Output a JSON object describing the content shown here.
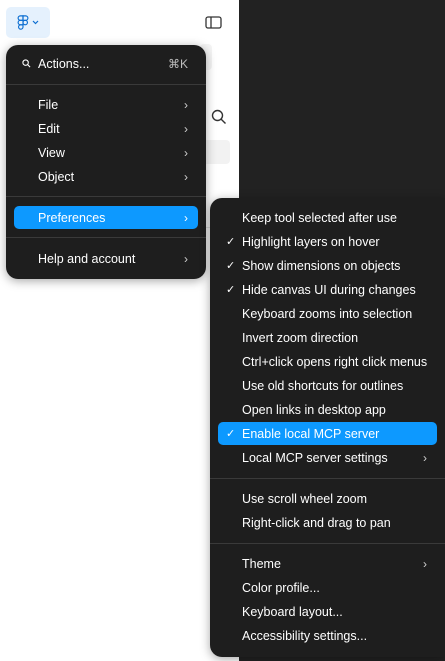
{
  "toolbar": {
    "logo_icon": "figma-logo-icon",
    "dropdown_icon": "chevron-down-icon",
    "sidebar_toggle_icon": "sidebar-toggle-icon",
    "search_icon": "search-icon"
  },
  "main_menu": {
    "actions_label": "Actions...",
    "actions_shortcut": "⌘K",
    "items": [
      {
        "label": "File",
        "arrow": "›"
      },
      {
        "label": "Edit",
        "arrow": "›"
      },
      {
        "label": "View",
        "arrow": "›"
      },
      {
        "label": "Object",
        "arrow": "›"
      },
      {
        "label": "Preferences",
        "arrow": "›",
        "active": true
      },
      {
        "label": "Help and account",
        "arrow": "›"
      }
    ]
  },
  "preferences_menu": {
    "items": [
      {
        "label": "Keep tool selected after use",
        "checked": false
      },
      {
        "label": "Highlight layers on hover",
        "checked": true,
        "check": "✓"
      },
      {
        "label": "Show dimensions on objects",
        "checked": true,
        "check": "✓"
      },
      {
        "label": "Hide canvas UI during changes",
        "checked": true,
        "check": "✓"
      },
      {
        "label": "Keyboard zooms into selection",
        "checked": false
      },
      {
        "label": "Invert zoom direction",
        "checked": false
      },
      {
        "label": "Ctrl+click opens right click menus",
        "checked": false
      },
      {
        "label": "Use old shortcuts for outlines",
        "checked": false
      },
      {
        "label": "Open links in desktop app",
        "checked": false
      },
      {
        "label": "Enable local MCP server",
        "checked": true,
        "check": "✓",
        "active": true
      },
      {
        "label": "Local MCP server settings",
        "arrow": "›"
      },
      {
        "label": "Use scroll wheel zoom"
      },
      {
        "label": "Right-click and drag to pan"
      },
      {
        "label": "Theme",
        "arrow": "›"
      },
      {
        "label": "Color profile..."
      },
      {
        "label": "Keyboard layout..."
      },
      {
        "label": "Accessibility settings..."
      }
    ]
  },
  "colors": {
    "accent": "#0d99ff",
    "menu_bg": "#1e1e1e",
    "canvas_bg": "#222222"
  }
}
